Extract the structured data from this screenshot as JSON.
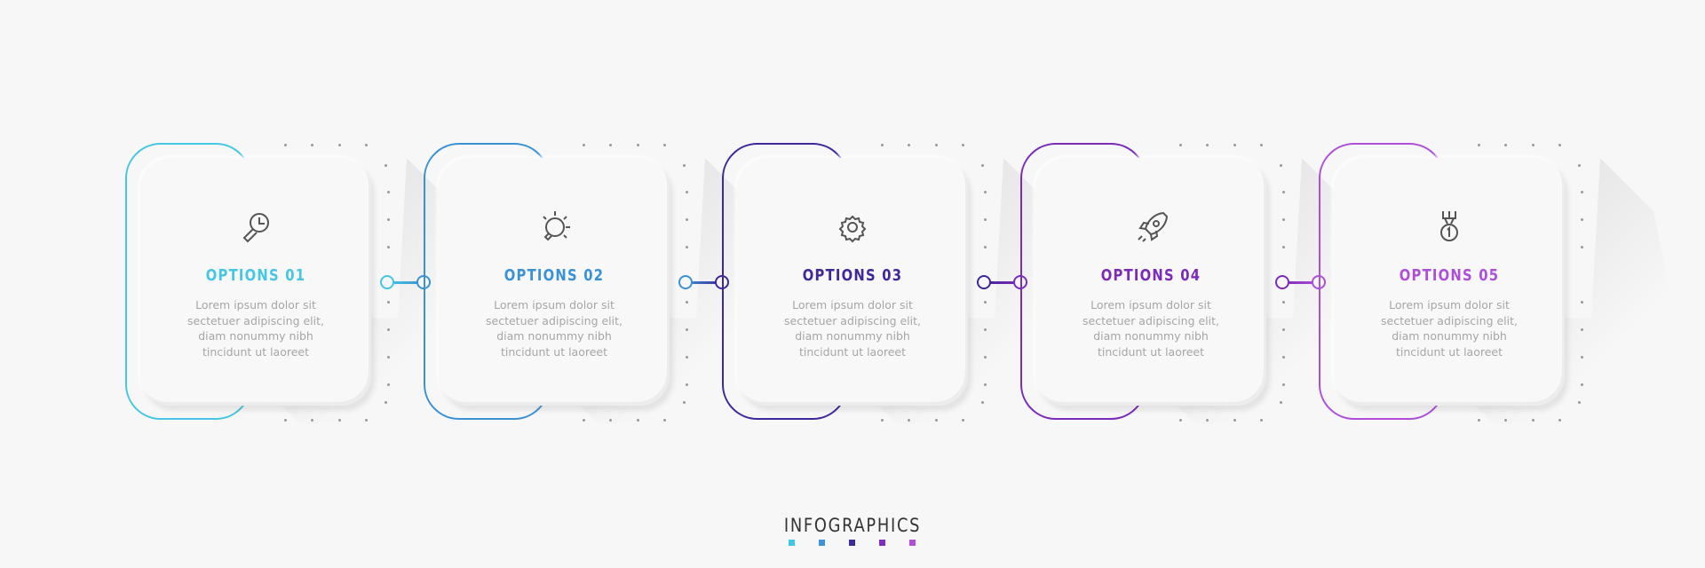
{
  "items": [
    {
      "title": "OPTIONS 01",
      "icon": "magnifier-clock-icon",
      "color": "#45c6e2",
      "text": [
        "Lorem ipsum dolor sit",
        "sectetuer adipiscing elit,",
        "diam nonummy nibh",
        "tincidunt ut laoreet"
      ]
    },
    {
      "title": "OPTIONS 02",
      "icon": "lightbulb-icon",
      "color": "#3a92d4",
      "text": [
        "Lorem ipsum dolor sit",
        "sectetuer adipiscing elit,",
        "diam nonummy nibh",
        "tincidunt ut laoreet"
      ]
    },
    {
      "title": "OPTIONS 03",
      "icon": "gear-icon",
      "color": "#40279a",
      "text": [
        "Lorem ipsum dolor sit",
        "sectetuer adipiscing elit,",
        "diam nonummy nibh",
        "tincidunt ut laoreet"
      ]
    },
    {
      "title": "OPTIONS 04",
      "icon": "rocket-icon",
      "color": "#7b2bb8",
      "text": [
        "Lorem ipsum dolor sit",
        "sectetuer adipiscing elit,",
        "diam nonummy nibh",
        "tincidunt ut laoreet"
      ]
    },
    {
      "title": "OPTIONS 05",
      "icon": "medal-icon",
      "color": "#ad4fd8",
      "text": [
        "Lorem ipsum dolor sit",
        "sectetuer adipiscing elit,",
        "diam nonummy nibh",
        "tincidunt ut laoreet"
      ]
    }
  ],
  "footer": {
    "title": "INFOGRAPHICS",
    "swatches": [
      "#3fc8e6",
      "#3a94d6",
      "#3f2a9c",
      "#7e2fbe",
      "#b04fd9"
    ]
  }
}
